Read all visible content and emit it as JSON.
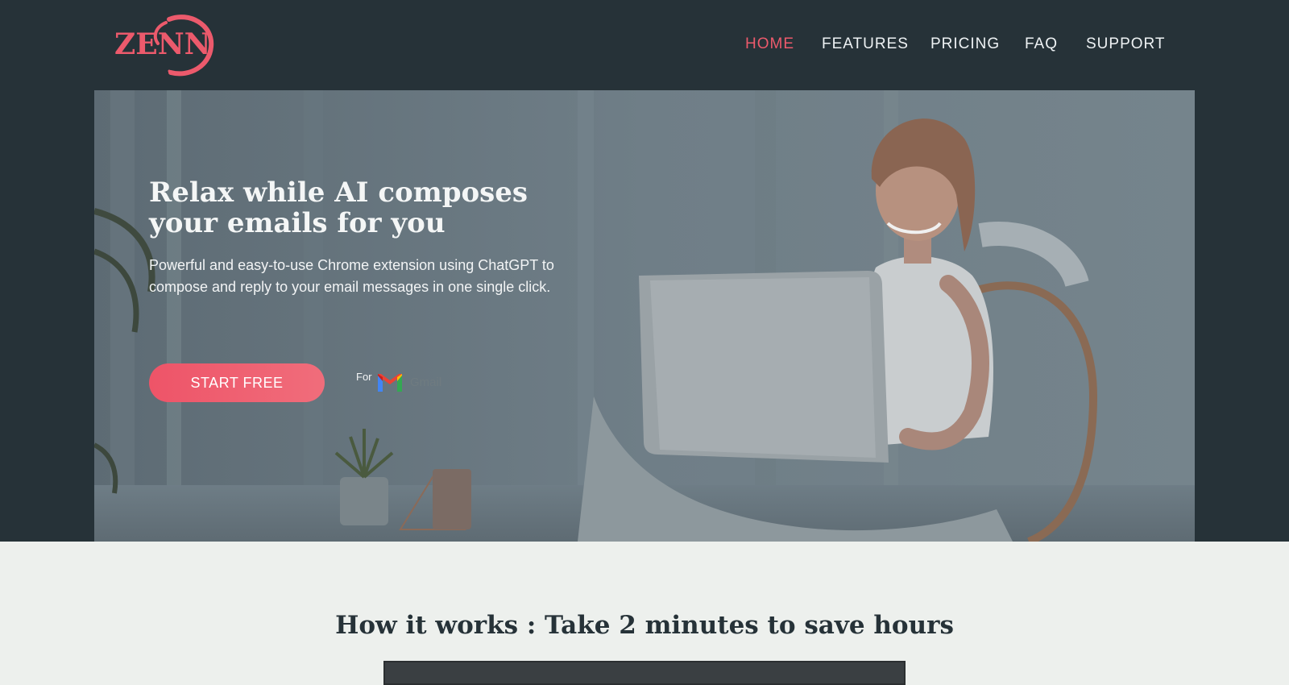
{
  "logo": {
    "text": "ZENN"
  },
  "nav": {
    "items": [
      {
        "label": "HOME",
        "active": true
      },
      {
        "label": "FEATURES",
        "active": false
      },
      {
        "label": "PRICING",
        "active": false
      },
      {
        "label": "FAQ",
        "active": false
      },
      {
        "label": "SUPPORT",
        "active": false
      }
    ]
  },
  "hero": {
    "title_line1": "Relax while AI composes",
    "title_line2": "your emails for you",
    "subtitle_line1": "Powerful and easy-to-use Chrome extension using ChatGPT to",
    "subtitle_line2": "compose and reply to your email messages in one single click.",
    "cta_label": "START FREE",
    "for_label": "For",
    "gmail_label": "Gmail",
    "gmail_icon": "gmail-icon"
  },
  "how_it_works": {
    "title": "How it works : Take 2 minutes to save hours"
  },
  "colors": {
    "header_bg": "#263238",
    "accent": "#ec5a6c",
    "page_bg": "#edf0ed"
  }
}
